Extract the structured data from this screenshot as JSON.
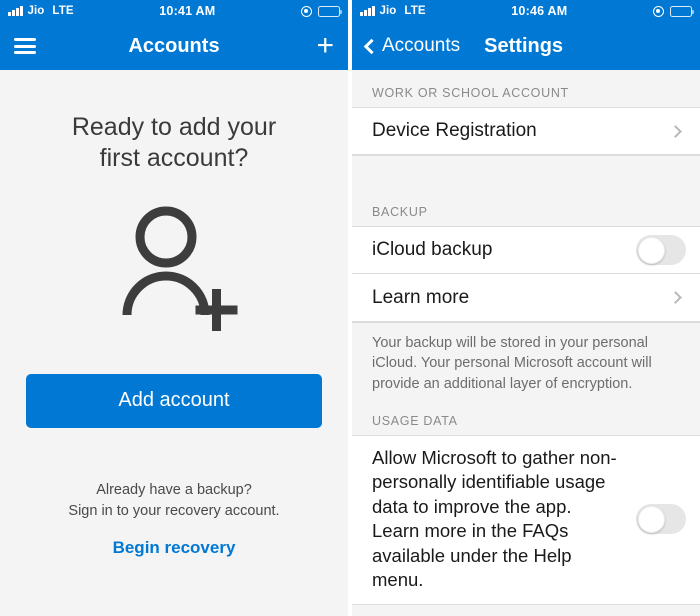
{
  "left": {
    "statusbar": {
      "carrier": "Jio",
      "network": "LTE",
      "time": "10:41 AM",
      "location_icon": "location-arrow-icon",
      "battery_icon": "battery-icon"
    },
    "nav": {
      "menu_icon": "hamburger-menu-icon",
      "title": "Accounts",
      "add_icon": "plus-icon"
    },
    "headline_line1": "Ready to add your",
    "headline_line2": "first account?",
    "illustration": "person-add-icon",
    "add_button": "Add account",
    "note_line1": "Already have a backup?",
    "note_line2": "Sign in to your recovery account.",
    "recovery_link": "Begin recovery"
  },
  "right": {
    "statusbar": {
      "carrier": "Jio",
      "network": "LTE",
      "time": "10:46 AM",
      "location_icon": "location-arrow-icon",
      "battery_icon": "battery-icon"
    },
    "nav": {
      "back_icon": "chevron-left-icon",
      "back_label": "Accounts",
      "title": "Settings"
    },
    "sections": [
      {
        "header": "WORK OR SCHOOL ACCOUNT",
        "rows": [
          {
            "label": "Device Registration",
            "accessory": "chevron-right-icon"
          }
        ]
      },
      {
        "header": "BACKUP",
        "rows": [
          {
            "label": "iCloud backup",
            "accessory": "toggle-off"
          },
          {
            "label": "Learn more",
            "accessory": "chevron-right-icon"
          }
        ],
        "footnote": "Your backup will be stored in your personal iCloud. Your personal Microsoft account will provide an additional layer of encryption."
      },
      {
        "header": "USAGE DATA",
        "rows": [
          {
            "label": "Allow Microsoft to gather non-personally identifiable usage data to improve the app. Learn more in the FAQs available under the Help menu.",
            "accessory": "toggle-off"
          }
        ]
      }
    ]
  },
  "colors": {
    "brand_blue": "#0078d4",
    "page_gray": "#f4f4f4",
    "text_dark": "#1a1a1a",
    "text_muted": "#8a8a8a"
  }
}
